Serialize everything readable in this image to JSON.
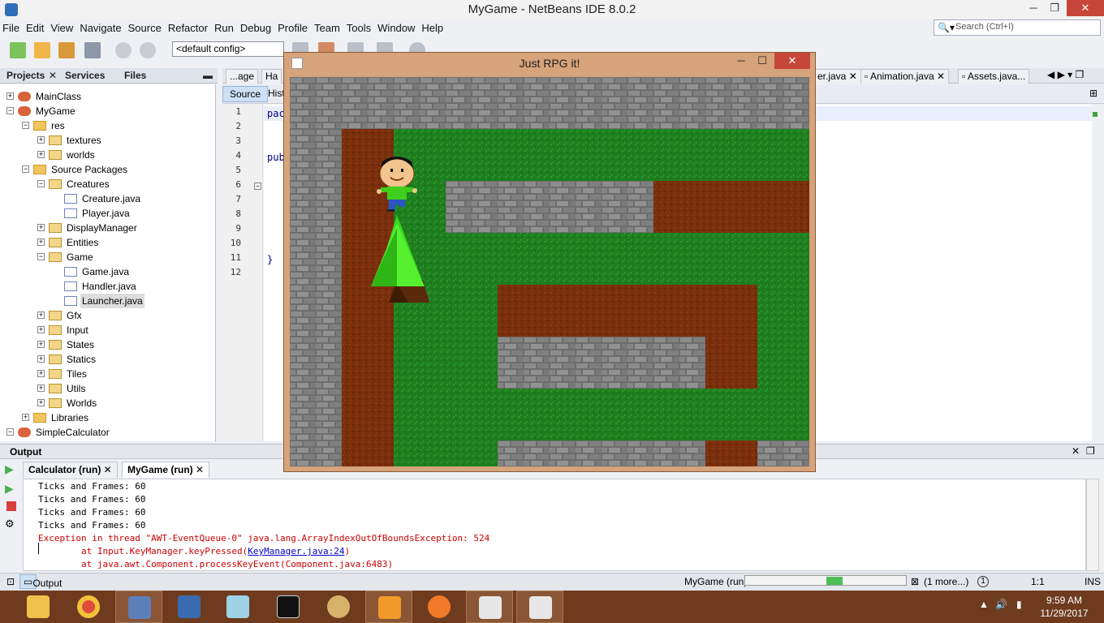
{
  "window": {
    "title": "MyGame - NetBeans IDE 8.0.2",
    "minimize": "─",
    "maximize": "❐",
    "close": "✕"
  },
  "menu": [
    "File",
    "Edit",
    "View",
    "Navigate",
    "Source",
    "Refactor",
    "Run",
    "Debug",
    "Profile",
    "Team",
    "Tools",
    "Window",
    "Help"
  ],
  "search": {
    "placeholder": "Search (Ctrl+I)",
    "icon": "search-icon"
  },
  "toolbar": {
    "config_value": "<default config>"
  },
  "projects": {
    "tabs": [
      "Projects",
      "Services",
      "Files"
    ],
    "tree": [
      {
        "label": "MainClass",
        "level": 0,
        "icon": "project-icon",
        "expanded": false
      },
      {
        "label": "MyGame",
        "level": 0,
        "icon": "project-icon",
        "expanded": true
      },
      {
        "label": "res",
        "level": 1,
        "icon": "folder-icon",
        "expanded": true
      },
      {
        "label": "textures",
        "level": 2,
        "icon": "package-icon",
        "expanded": false
      },
      {
        "label": "worlds",
        "level": 2,
        "icon": "package-icon",
        "expanded": false
      },
      {
        "label": "Source Packages",
        "level": 1,
        "icon": "folder-icon",
        "expanded": true
      },
      {
        "label": "Creatures",
        "level": 2,
        "icon": "package-icon",
        "expanded": true
      },
      {
        "label": "Creature.java",
        "level": 3,
        "icon": "java-file-icon"
      },
      {
        "label": "Player.java",
        "level": 3,
        "icon": "java-file-icon"
      },
      {
        "label": "DisplayManager",
        "level": 2,
        "icon": "package-icon",
        "expanded": false
      },
      {
        "label": "Entities",
        "level": 2,
        "icon": "package-icon",
        "expanded": false
      },
      {
        "label": "Game",
        "level": 2,
        "icon": "package-icon",
        "expanded": true
      },
      {
        "label": "Game.java",
        "level": 3,
        "icon": "java-file-icon"
      },
      {
        "label": "Handler.java",
        "level": 3,
        "icon": "java-file-icon"
      },
      {
        "label": "Launcher.java",
        "level": 3,
        "icon": "java-file-icon",
        "selected": true
      },
      {
        "label": "Gfx",
        "level": 2,
        "icon": "package-icon",
        "expanded": false
      },
      {
        "label": "Input",
        "level": 2,
        "icon": "package-icon",
        "expanded": false
      },
      {
        "label": "States",
        "level": 2,
        "icon": "package-icon",
        "expanded": false
      },
      {
        "label": "Statics",
        "level": 2,
        "icon": "package-icon",
        "expanded": false
      },
      {
        "label": "Tiles",
        "level": 2,
        "icon": "package-icon",
        "expanded": false
      },
      {
        "label": "Utils",
        "level": 2,
        "icon": "package-icon",
        "expanded": false
      },
      {
        "label": "Worlds",
        "level": 2,
        "icon": "package-icon",
        "expanded": false
      },
      {
        "label": "Libraries",
        "level": 1,
        "icon": "folder-icon",
        "expanded": false
      },
      {
        "label": "SimpleCalculator",
        "level": 0,
        "icon": "project-icon",
        "expanded": true
      }
    ]
  },
  "editor": {
    "tabs": [
      {
        "label": "...age"
      },
      {
        "label": "Ha"
      },
      {
        "label": "er.java"
      },
      {
        "label": "Animation.java"
      },
      {
        "label": "Assets.java..."
      }
    ],
    "subtabs": {
      "source": "Source",
      "history": "Hist"
    },
    "line_numbers": [
      "1",
      "2",
      "3",
      "4",
      "5",
      "6",
      "7",
      "8",
      "9",
      "10",
      "11",
      "12"
    ],
    "code": {
      "line1": "pac",
      "line4": "pub",
      "line11": "}"
    }
  },
  "output": {
    "title": "Output",
    "tabs": [
      {
        "label": "Calculator (run)"
      },
      {
        "label": "MyGame (run)"
      }
    ],
    "lines": [
      {
        "text": "Ticks and Frames: 60",
        "type": "normal"
      },
      {
        "text": "Ticks and Frames: 60",
        "type": "normal"
      },
      {
        "text": "Ticks and Frames: 60",
        "type": "normal"
      },
      {
        "text": "Ticks and Frames: 60",
        "type": "normal"
      },
      {
        "text": "Exception in thread \"AWT-EventQueue-0\" java.lang.ArrayIndexOutOfBoundsException: 524",
        "type": "error"
      },
      {
        "prefix": "        at Input.KeyManager.keyPressed(",
        "link": "KeyManager.java:24",
        "suffix": ")",
        "type": "error-link"
      },
      {
        "text": "        at java.awt.Component.processKeyEvent(Component.java:6483)",
        "type": "error"
      }
    ]
  },
  "statusbar": {
    "output_tab": "Output",
    "task": "MyGame (run)",
    "progress_fraction": 0.1,
    "more": "(1 more...)",
    "notifications": "1",
    "position": "1:1",
    "mode": "INS"
  },
  "game_window": {
    "title": "Just RPG it!",
    "minimize": "─",
    "maximize": "☐",
    "close": "✕"
  },
  "taskbar": {
    "time": "9:59 AM",
    "date": "11/29/2017",
    "apps": [
      "file-explorer-icon",
      "chrome-icon",
      "virtualbox-icon",
      "remote-desktop-icon",
      "notepad-icon",
      "command-prompt-icon",
      "paint-icon",
      "sublime-text-icon",
      "xampp-icon",
      "java-icon",
      "java-icon"
    ]
  },
  "colors": {
    "grass": "#1f7f1f",
    "dirt": "#7a2f0c",
    "stone": "#747474",
    "game_frame": "#d6a37a",
    "taskbar": "#6e3b1f",
    "error_text": "#cc0000"
  }
}
